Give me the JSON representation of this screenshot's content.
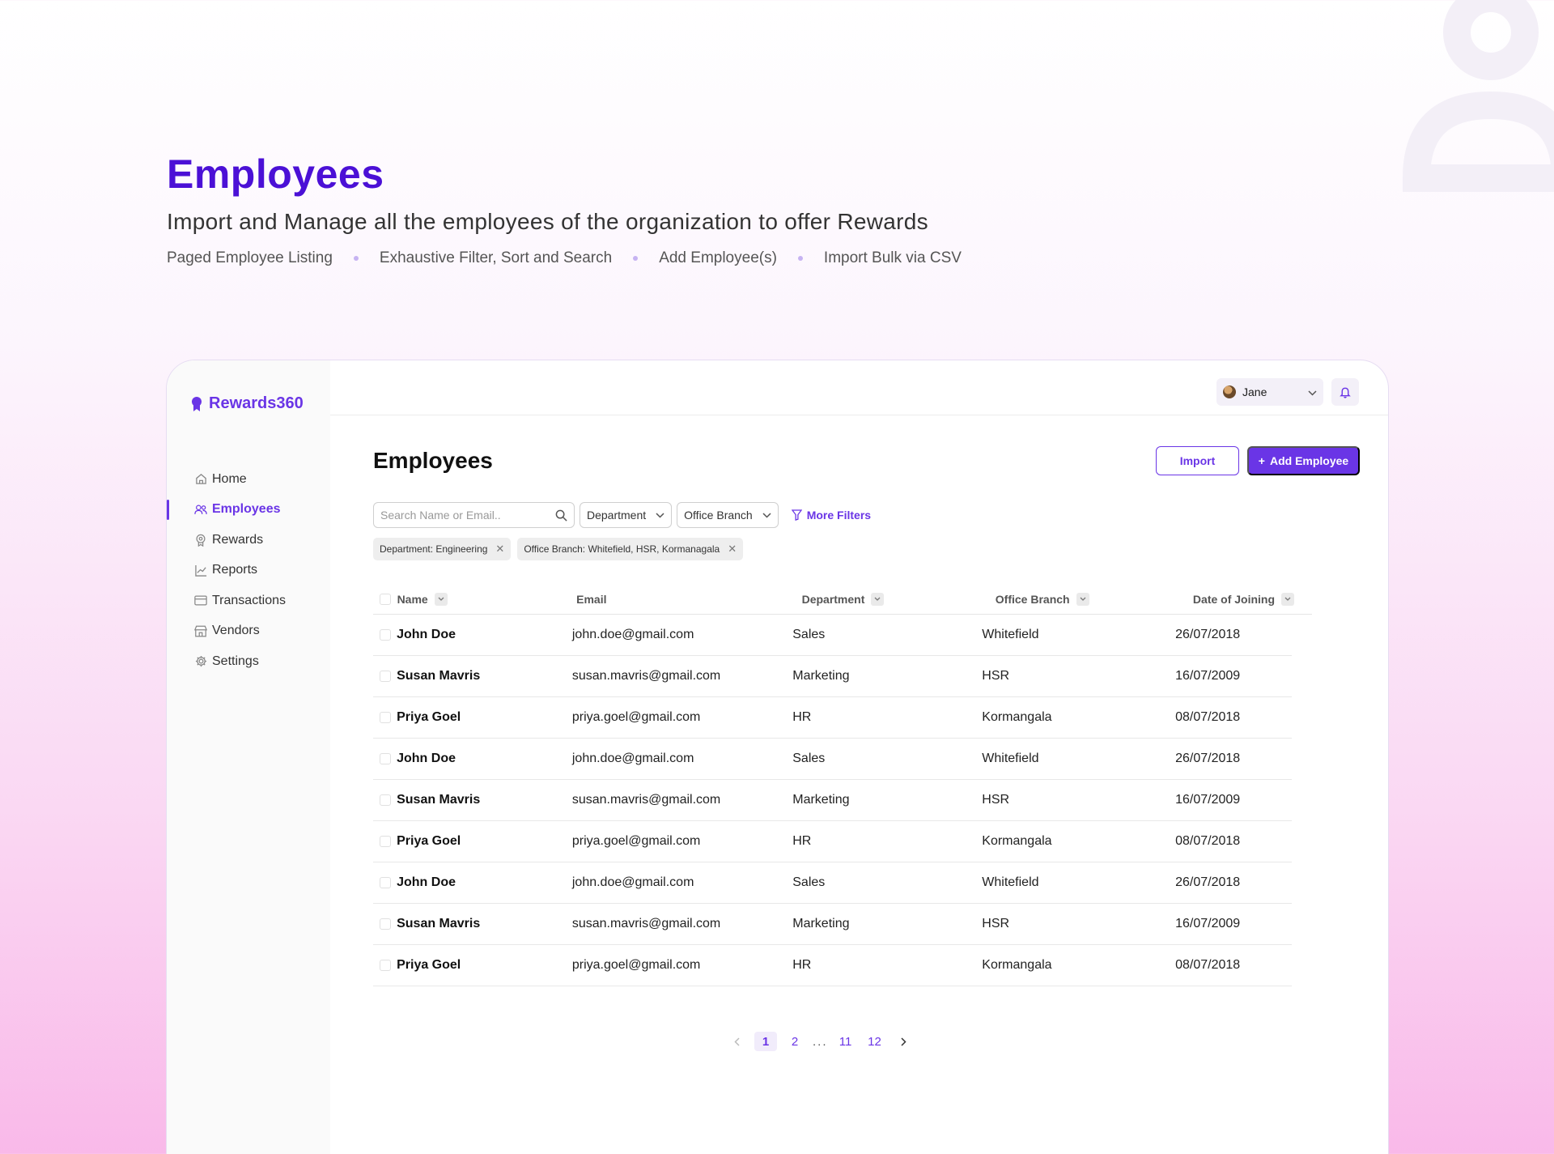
{
  "hero": {
    "title": "Employees",
    "subtitle": "Import and Manage all the employees of the organization to offer Rewards",
    "features": [
      "Paged Employee Listing",
      "Exhaustive Filter, Sort and Search",
      "Add Employee(s)",
      "Import Bulk via CSV"
    ]
  },
  "app": {
    "logo": "Rewards360",
    "nav": [
      {
        "label": "Home",
        "icon": "home-icon",
        "active": false
      },
      {
        "label": "Employees",
        "icon": "users-icon",
        "active": true
      },
      {
        "label": "Rewards",
        "icon": "award-icon",
        "active": false
      },
      {
        "label": "Reports",
        "icon": "chart-icon",
        "active": false
      },
      {
        "label": "Transactions",
        "icon": "card-icon",
        "active": false
      },
      {
        "label": "Vendors",
        "icon": "store-icon",
        "active": false
      },
      {
        "label": "Settings",
        "icon": "gear-icon",
        "active": false
      }
    ],
    "user": {
      "name": "Jane"
    },
    "page_title": "Employees",
    "buttons": {
      "import": "Import",
      "add": "Add Employee"
    },
    "search": {
      "placeholder": "Search Name or Email.."
    },
    "filters": {
      "department": "Department",
      "branch": "Office Branch",
      "more": "More Filters"
    },
    "chips": [
      "Department: Engineering",
      "Office Branch: Whitefield, HSR, Kormanagala"
    ],
    "table": {
      "headers": [
        "Name",
        "Email",
        "Department",
        "Office Branch",
        "Date of Joining"
      ],
      "rows": [
        [
          "John Doe",
          "john.doe@gmail.com",
          "Sales",
          "Whitefield",
          "26/07/2018"
        ],
        [
          "Susan Mavris",
          "susan.mavris@gmail.com",
          "Marketing",
          "HSR",
          "16/07/2009"
        ],
        [
          "Priya Goel",
          "priya.goel@gmail.com",
          "HR",
          "Kormangala",
          "08/07/2018"
        ],
        [
          "John Doe",
          "john.doe@gmail.com",
          "Sales",
          "Whitefield",
          "26/07/2018"
        ],
        [
          "Susan Mavris",
          "susan.mavris@gmail.com",
          "Marketing",
          "HSR",
          "16/07/2009"
        ],
        [
          "Priya Goel",
          "priya.goel@gmail.com",
          "HR",
          "Kormangala",
          "08/07/2018"
        ],
        [
          "John Doe",
          "john.doe@gmail.com",
          "Sales",
          "Whitefield",
          "26/07/2018"
        ],
        [
          "Susan Mavris",
          "susan.mavris@gmail.com",
          "Marketing",
          "HSR",
          "16/07/2009"
        ],
        [
          "Priya Goel",
          "priya.goel@gmail.com",
          "HR",
          "Kormangala",
          "08/07/2018"
        ]
      ]
    },
    "pagination": {
      "pages": [
        "1",
        "2",
        "...",
        "11",
        "12"
      ],
      "current": "1"
    },
    "colors": {
      "accent": "#6a35e6",
      "hero_title": "#4b10d6"
    }
  }
}
